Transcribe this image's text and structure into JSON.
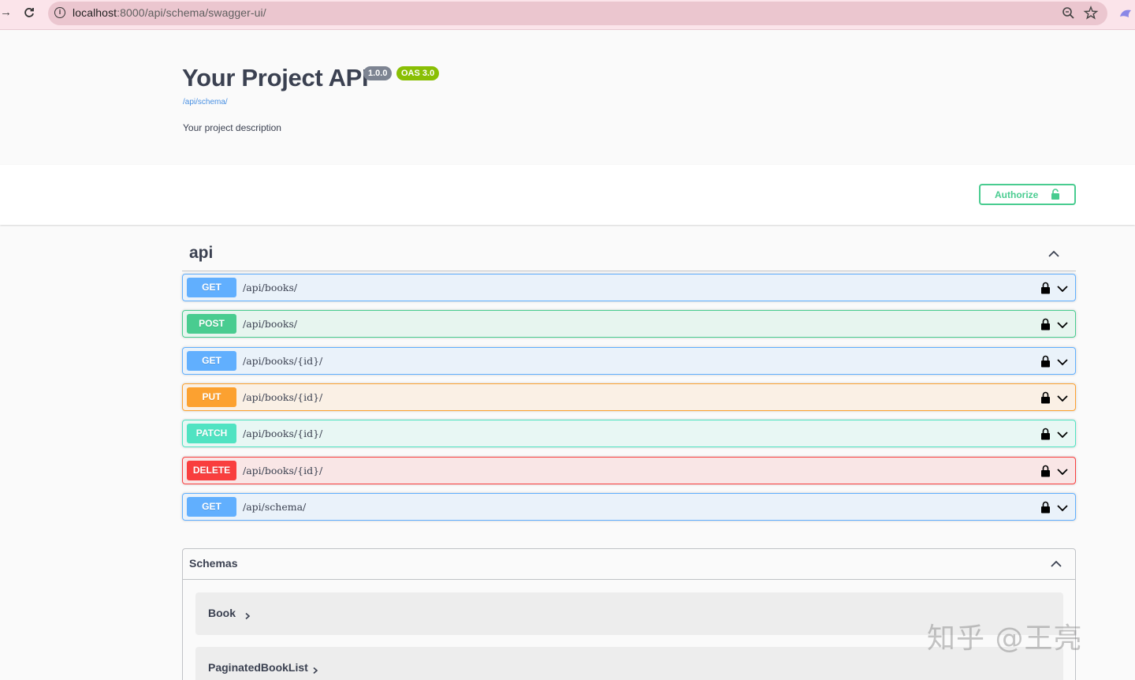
{
  "browser": {
    "url_host": "localhost",
    "url_rest": ":8000/api/schema/swagger-ui/"
  },
  "info": {
    "title": "Your Project API",
    "version": "1.0.0",
    "oas": "OAS 3.0",
    "base_url": "/api/schema/",
    "description": "Your project description"
  },
  "authorize": {
    "label": "Authorize"
  },
  "tag": {
    "name": "api"
  },
  "operations": [
    {
      "method": "GET",
      "path": "/api/books/"
    },
    {
      "method": "POST",
      "path": "/api/books/"
    },
    {
      "method": "GET",
      "path": "/api/books/{id}/"
    },
    {
      "method": "PUT",
      "path": "/api/books/{id}/"
    },
    {
      "method": "PATCH",
      "path": "/api/books/{id}/"
    },
    {
      "method": "DELETE",
      "path": "/api/books/{id}/"
    },
    {
      "method": "GET",
      "path": "/api/schema/"
    }
  ],
  "schemas": {
    "title": "Schemas",
    "models": [
      "Book",
      "PaginatedBookList"
    ]
  },
  "watermark": "知乎 @王亮",
  "colors": {
    "get": "#61affe",
    "post": "#49cc90",
    "put": "#fca130",
    "patch": "#50e3c2",
    "delete": "#f93e3e",
    "authorize": "#49cc90"
  }
}
